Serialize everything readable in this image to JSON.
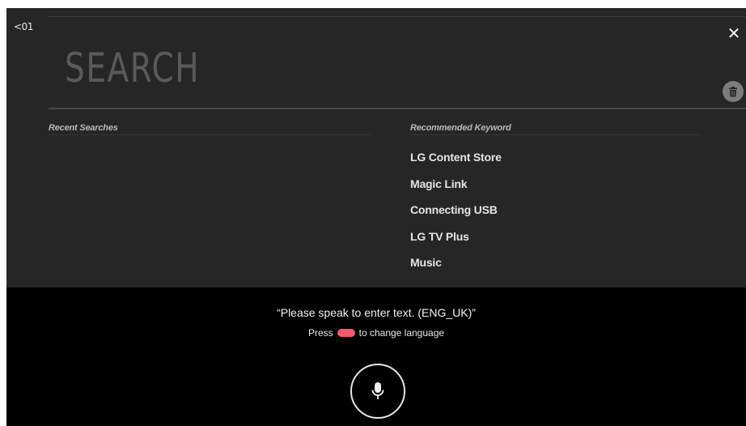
{
  "header": {
    "back_label": "<01",
    "title": "SEARCH",
    "close_icon": "close-icon",
    "delete_icon": "trash-icon"
  },
  "recent": {
    "title": "Recent Searches",
    "items": []
  },
  "recommended": {
    "title": "Recommended Keyword",
    "items": [
      {
        "label": "LG Content Store"
      },
      {
        "label": "Magic Link"
      },
      {
        "label": "Connecting USB"
      },
      {
        "label": "LG TV Plus"
      },
      {
        "label": "Music"
      }
    ]
  },
  "voice": {
    "prompt": "“Please speak to enter text. (ENG_UK)”",
    "hint_prefix": "Press",
    "hint_suffix": "to change language",
    "red_key_color": "#f25b6b",
    "mic_icon": "microphone-icon"
  },
  "colors": {
    "background": "#262626",
    "voice_panel": "#000000",
    "accent_red": "#f25b6b"
  }
}
